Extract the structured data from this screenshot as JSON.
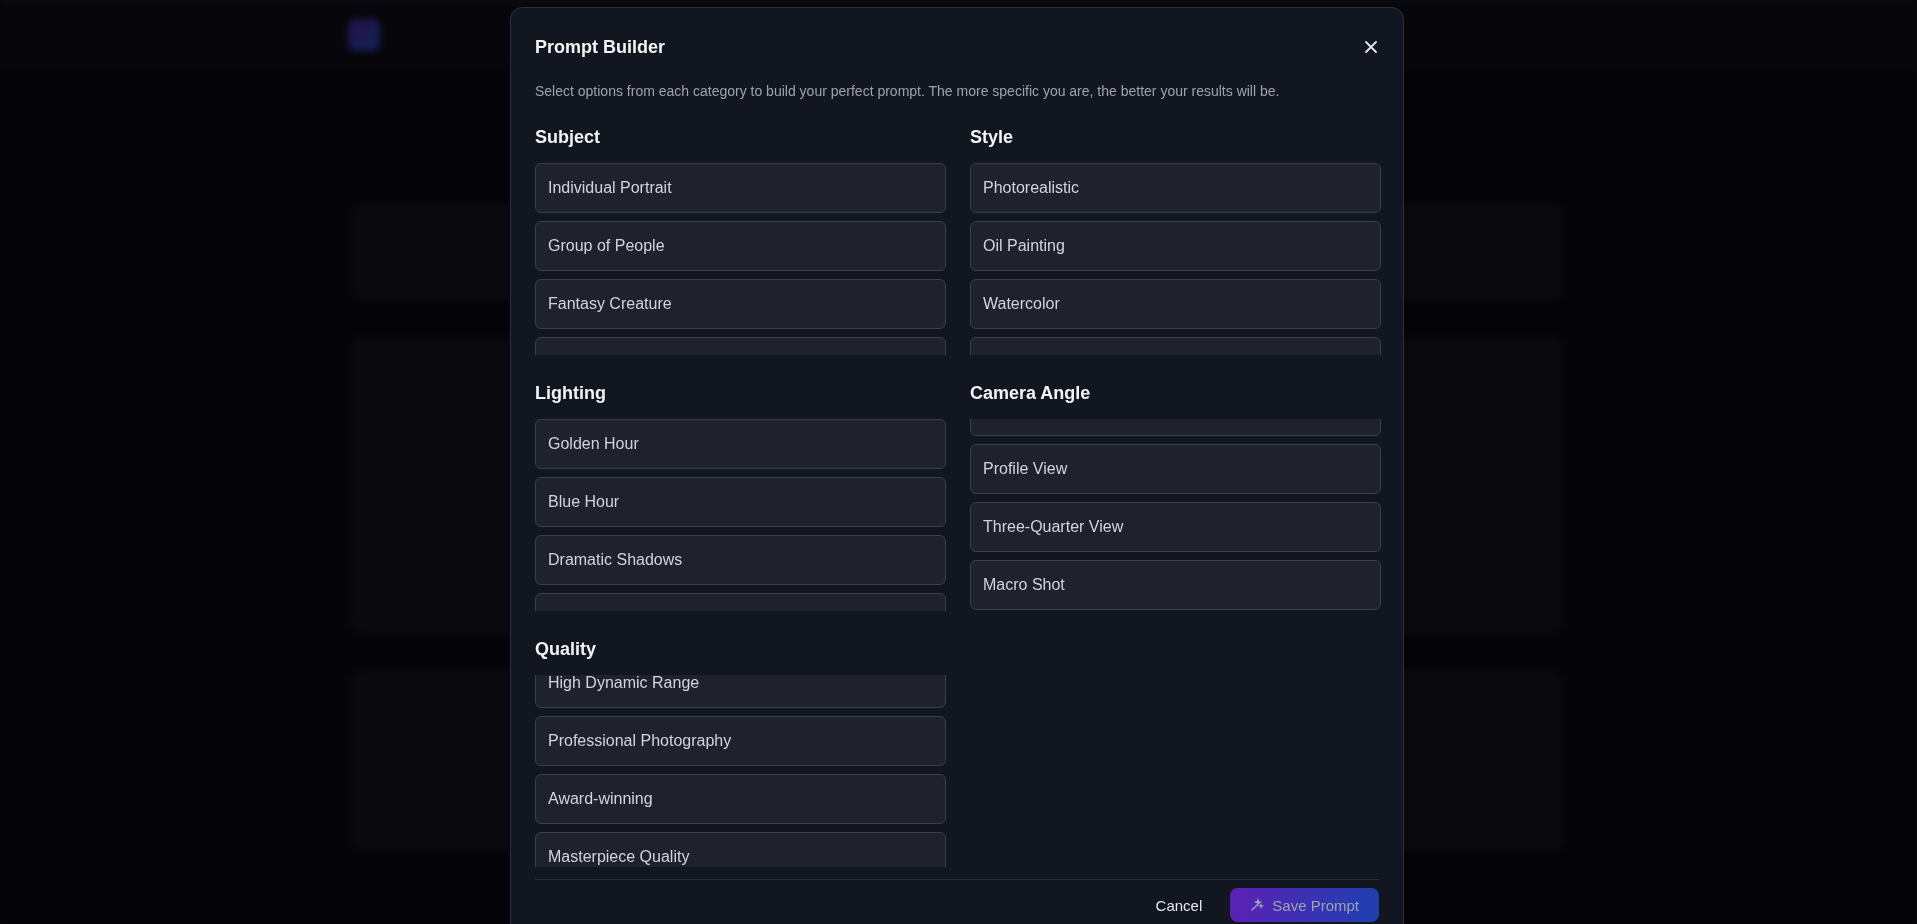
{
  "dialog": {
    "title": "Prompt Builder",
    "description": "Select options from each category to build your perfect prompt. The more specific you are, the better your results will be.",
    "categories": [
      {
        "name": "Subject",
        "at_top": true,
        "at_end": false,
        "options": [
          "Individual Portrait",
          "Group of People",
          "Fantasy Creature"
        ]
      },
      {
        "name": "Style",
        "at_top": true,
        "at_end": false,
        "options": [
          "Photorealistic",
          "Oil Painting",
          "Watercolor"
        ]
      },
      {
        "name": "Lighting",
        "at_top": true,
        "at_end": false,
        "options": [
          "Golden Hour",
          "Blue Hour",
          "Dramatic Shadows"
        ]
      },
      {
        "name": "Camera Angle",
        "at_top": false,
        "at_end": true,
        "options": [
          "Profile View",
          "Three-Quarter View",
          "Macro Shot"
        ]
      },
      {
        "name": "Quality",
        "at_top": false,
        "at_end": false,
        "options": [
          "High Dynamic Range",
          "Professional Photography",
          "Award-winning",
          "Masterpiece Quality"
        ]
      }
    ],
    "buttons": [
      {
        "label": "Cancel",
        "kind": "text"
      },
      {
        "label": "Save Prompt",
        "kind": "primary"
      }
    ]
  }
}
